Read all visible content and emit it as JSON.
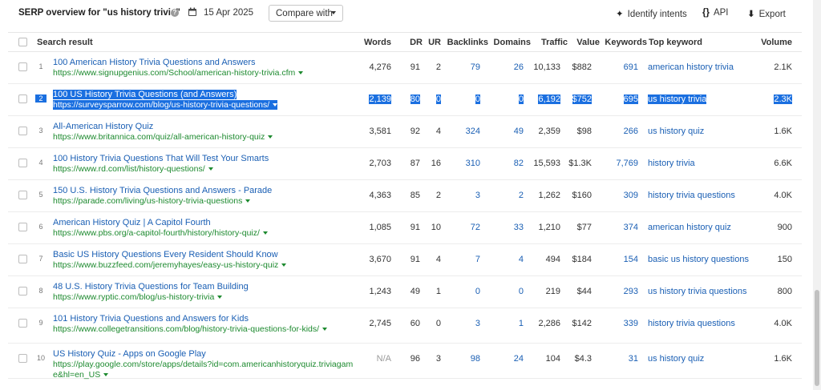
{
  "header": {
    "title": "SERP overview for \"us history trivia\"",
    "date": "15 Apr 2025",
    "compare_label": "Compare with",
    "identify_label": "Identify intents",
    "api_label": "API",
    "export_label": "Export"
  },
  "columns": {
    "search_result": "Search result",
    "words": "Words",
    "dr": "DR",
    "ur": "UR",
    "backlinks": "Backlinks",
    "domains": "Domains",
    "traffic": "Traffic",
    "value": "Value",
    "keywords": "Keywords",
    "top_keyword": "Top keyword",
    "volume": "Volume"
  },
  "rows": [
    {
      "n": "1",
      "title": "100 American History Trivia Questions and Answers",
      "url": "https://www.signupgenius.com/School/american-history-trivia.cfm",
      "words": "4,276",
      "dr": "91",
      "ur": "2",
      "backlinks": "79",
      "domains": "26",
      "traffic": "10,133",
      "value": "$882",
      "keywords": "691",
      "top_keyword": "american history trivia",
      "volume": "2.1K"
    },
    {
      "n": "2",
      "title": "100 US History Trivia Questions (and Answers)",
      "url": "https://surveysparrow.com/blog/us-history-trivia-questions/",
      "words": "2,139",
      "dr": "80",
      "ur": "0",
      "backlinks": "0",
      "domains": "0",
      "traffic": "6,192",
      "value": "$752",
      "keywords": "695",
      "top_keyword": "us history trivia",
      "volume": "2.3K"
    },
    {
      "n": "3",
      "title": "All-American History Quiz",
      "url": "https://www.britannica.com/quiz/all-american-history-quiz",
      "words": "3,581",
      "dr": "92",
      "ur": "4",
      "backlinks": "324",
      "domains": "49",
      "traffic": "2,359",
      "value": "$98",
      "keywords": "266",
      "top_keyword": "us history quiz",
      "volume": "1.6K"
    },
    {
      "n": "4",
      "title": "100 History Trivia Questions That Will Test Your Smarts",
      "url": "https://www.rd.com/list/history-questions/",
      "words": "2,703",
      "dr": "87",
      "ur": "16",
      "backlinks": "310",
      "domains": "82",
      "traffic": "15,593",
      "value": "$1.3K",
      "keywords": "7,769",
      "top_keyword": "history trivia",
      "volume": "6.6K"
    },
    {
      "n": "5",
      "title": "150 U.S. History Trivia Questions and Answers - Parade",
      "url": "https://parade.com/living/us-history-trivia-questions",
      "words": "4,363",
      "dr": "85",
      "ur": "2",
      "backlinks": "3",
      "domains": "2",
      "traffic": "1,262",
      "value": "$160",
      "keywords": "309",
      "top_keyword": "history trivia questions",
      "volume": "4.0K"
    },
    {
      "n": "6",
      "title": "American History Quiz | A Capitol Fourth",
      "url": "https://www.pbs.org/a-capitol-fourth/history/history-quiz/",
      "words": "1,085",
      "dr": "91",
      "ur": "10",
      "backlinks": "72",
      "domains": "33",
      "traffic": "1,210",
      "value": "$77",
      "keywords": "374",
      "top_keyword": "american history quiz",
      "volume": "900"
    },
    {
      "n": "7",
      "title": "Basic US History Questions Every Resident Should Know",
      "url": "https://www.buzzfeed.com/jeremyhayes/easy-us-history-quiz",
      "words": "3,670",
      "dr": "91",
      "ur": "4",
      "backlinks": "7",
      "domains": "4",
      "traffic": "494",
      "value": "$184",
      "keywords": "154",
      "top_keyword": "basic us history questions",
      "volume": "150"
    },
    {
      "n": "8",
      "title": "48 U.S. History Trivia Questions for Team Building",
      "url": "https://www.ryptic.com/blog/us-history-trivia",
      "words": "1,243",
      "dr": "49",
      "ur": "1",
      "backlinks": "0",
      "domains": "0",
      "traffic": "219",
      "value": "$44",
      "keywords": "293",
      "top_keyword": "us history trivia questions",
      "volume": "800"
    },
    {
      "n": "9",
      "title": "101 History Trivia Questions and Answers for Kids",
      "url": "https://www.collegetransitions.com/blog/history-trivia-questions-for-kids/",
      "words": "2,745",
      "dr": "60",
      "ur": "0",
      "backlinks": "3",
      "domains": "1",
      "traffic": "2,286",
      "value": "$142",
      "keywords": "339",
      "top_keyword": "history trivia questions",
      "volume": "4.0K"
    },
    {
      "n": "10",
      "title": "US History Quiz - Apps on Google Play",
      "url": "https://play.google.com/store/apps/details?id=com.americanhistoryquiz.triviagame&hl=en_US",
      "words": "N/A",
      "dr": "96",
      "ur": "3",
      "backlinks": "98",
      "domains": "24",
      "traffic": "104",
      "value": "$4.3",
      "keywords": "31",
      "top_keyword": "us history quiz",
      "volume": "1.6K"
    }
  ],
  "selected_row": "2",
  "colors": {
    "link": "#1a5fb4",
    "url": "#1d8a2f",
    "selection": "#1a6fe0"
  },
  "icons": [
    "help-icon",
    "calendar-icon",
    "chevron-down-icon",
    "sparkle-icon",
    "code-icon",
    "export-icon"
  ]
}
